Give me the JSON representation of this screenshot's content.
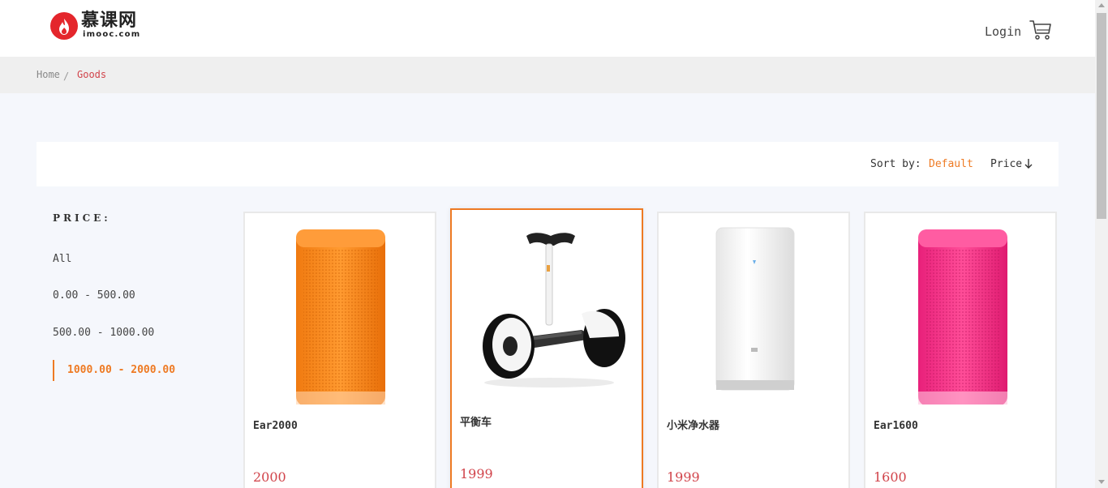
{
  "header": {
    "logo_cn": "慕课网",
    "logo_en": "imooc.com",
    "login_label": "Login",
    "cart_icon": "shopping-cart-icon"
  },
  "breadcrumb": {
    "home": "Home",
    "separator": "/",
    "current": "Goods"
  },
  "sort": {
    "label": "Sort by:",
    "default_label": "Default",
    "price_label": "Price",
    "price_direction_icon": "arrow-down-icon"
  },
  "filter": {
    "title": "PRICE:",
    "options": [
      "All",
      "0.00 - 500.00",
      "500.00 - 1000.00",
      "1000.00 - 2000.00"
    ],
    "selected": "1000.00 - 2000.00"
  },
  "products": [
    {
      "name": "Ear2000",
      "price": "2000",
      "image": "orange-speaker"
    },
    {
      "name": "平衡车",
      "price": "1999",
      "image": "balance-scooter"
    },
    {
      "name": "小米净水器",
      "price": "1999",
      "image": "water-purifier"
    },
    {
      "name": "Ear1600",
      "price": "1600",
      "image": "pink-speaker"
    }
  ],
  "colors": {
    "accent": "#ee7a23",
    "price": "#d1434a",
    "brand_red": "#e4262c",
    "page_bg": "#f5f7fc"
  }
}
